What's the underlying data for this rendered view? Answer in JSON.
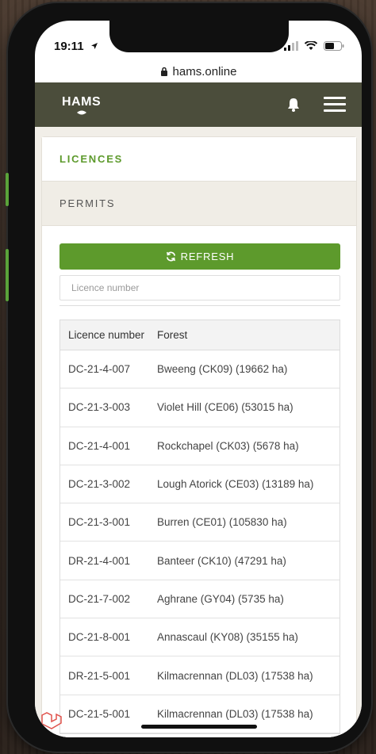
{
  "status_bar": {
    "time": "19:11"
  },
  "browser": {
    "url": "hams.online"
  },
  "app": {
    "logo": "HAMS"
  },
  "tabs": {
    "licences": "LICENCES",
    "permits": "PERMITS"
  },
  "actions": {
    "refresh_label": "REFRESH"
  },
  "search": {
    "placeholder": "Licence number"
  },
  "table": {
    "headers": [
      "Licence number",
      "Forest"
    ],
    "rows": [
      [
        "DC-21-4-007",
        "Bweeng (CK09) (19662 ha)"
      ],
      [
        "DC-21-3-003",
        "Violet Hill (CE06) (53015 ha)"
      ],
      [
        "DC-21-4-001",
        "Rockchapel (CK03) (5678 ha)"
      ],
      [
        "DC-21-3-002",
        "Lough Atorick (CE03) (13189 ha)"
      ],
      [
        "DC-21-3-001",
        "Burren (CE01) (105830 ha)"
      ],
      [
        "DR-21-4-001",
        "Banteer (CK10) (47291 ha)"
      ],
      [
        "DC-21-7-002",
        "Aghrane (GY04) (5735 ha)"
      ],
      [
        "DC-21-8-001",
        "Annascaul (KY08) (35155 ha)"
      ],
      [
        "DR-21-5-001",
        "Kilmacrennan (DL03) (17538 ha)"
      ],
      [
        "DC-21-5-001",
        "Kilmacrennan (DL03) (17538 ha)"
      ]
    ]
  },
  "colors": {
    "header_bg": "#4b4d3b",
    "accent": "#5d9a2c",
    "permits_bg": "#f0ede6"
  },
  "icons": [
    "location-arrow-icon",
    "signal-icon",
    "wifi-icon",
    "battery-icon",
    "lock-icon",
    "bell-icon",
    "menu-icon",
    "refresh-icon",
    "laravel-icon"
  ]
}
